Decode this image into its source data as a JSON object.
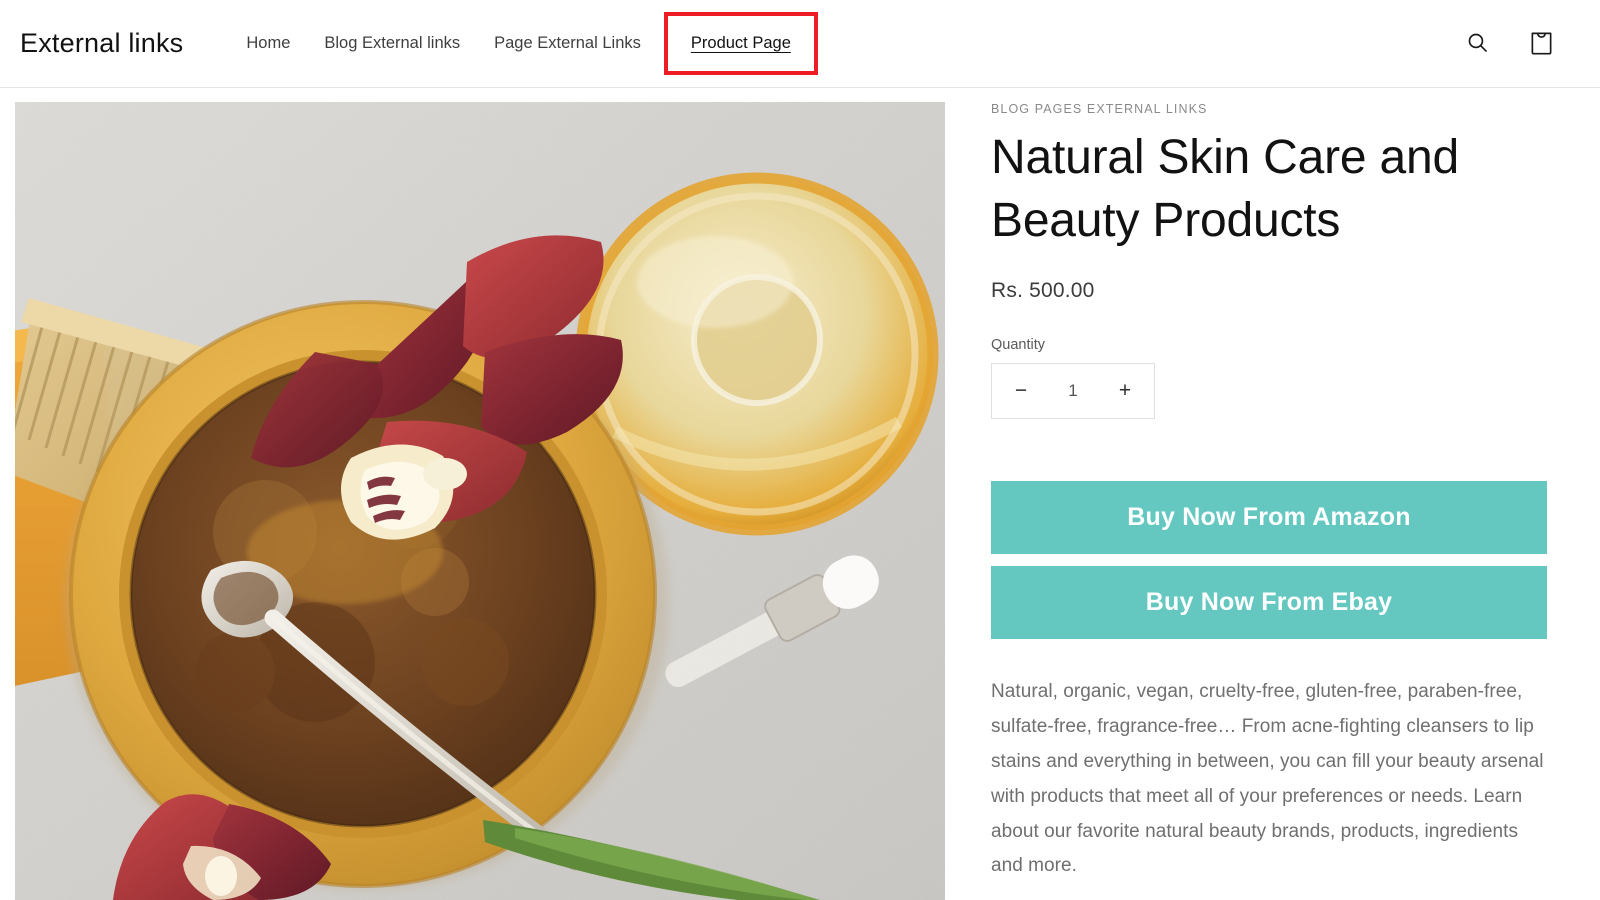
{
  "header": {
    "brand": "External links",
    "nav": [
      {
        "label": "Home",
        "active": false,
        "highlighted": false
      },
      {
        "label": "Blog External links",
        "active": false,
        "highlighted": false
      },
      {
        "label": "Page External Links",
        "active": false,
        "highlighted": false
      },
      {
        "label": "Product Page",
        "active": true,
        "highlighted": true
      }
    ],
    "search_icon": "search-icon",
    "cart_icon": "shopping-bag-icon",
    "highlight_color": "#ee1c25"
  },
  "product": {
    "breadcrumb": "BLOG PAGES EXTERNAL LINKS",
    "title": "Natural Skin Care and Beauty Products",
    "price": "Rs. 500.00",
    "quantity_label": "Quantity",
    "quantity_value": "1",
    "decrease_label": "−",
    "increase_label": "+",
    "buy_amazon_label": "Buy Now From Amazon",
    "buy_ebay_label": "Buy Now From Ebay",
    "button_color": "#64c8c1",
    "description": "Natural, organic, vegan, cruelty-free, gluten-free, paraben-free, sulfate-free, fragrance-free… From acne-fighting cleansers to lip stains and everything in between, you can fill your beauty arsenal with products that meet all of your preferences or needs. Learn about our favorite natural beauty brands, products, ingredients and more.",
    "image_alt": "Bowl of brown sugar body scrub with spoon, red orchid flowers, bamboo mat and amber oil bottle with dropper on grey linen"
  }
}
